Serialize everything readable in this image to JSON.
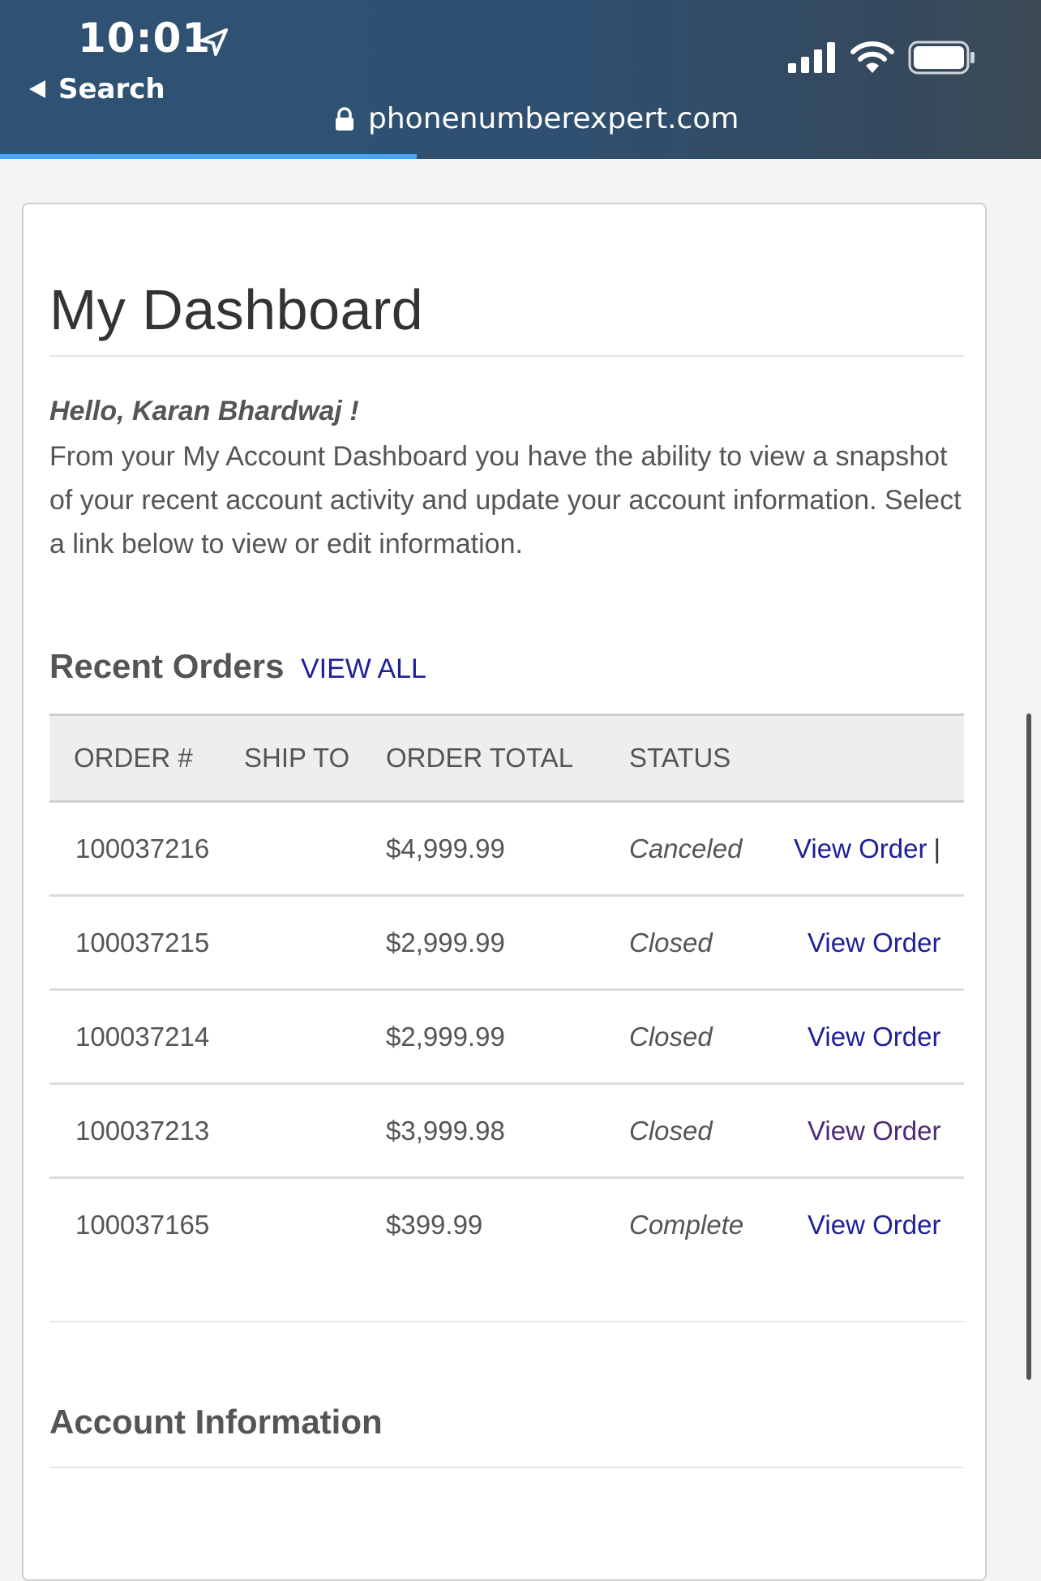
{
  "status_bar": {
    "time": "10:01",
    "back_label": "Search"
  },
  "browser": {
    "url": "phonenumberexpert.com"
  },
  "dashboard": {
    "title": "My Dashboard",
    "greeting": "Hello, Karan Bhardwaj !",
    "intro": "From your My Account Dashboard you have the ability to view a snapshot of your recent account activity and update your account information. Select a link below to view or edit information."
  },
  "recent_orders": {
    "title": "Recent Orders",
    "view_all": "VIEW ALL",
    "columns": [
      "ORDER #",
      "SHIP TO",
      "ORDER TOTAL",
      "STATUS"
    ],
    "rows": [
      {
        "order": "100037216",
        "ship_to": "",
        "total": "$4,999.99",
        "status": "Canceled",
        "action": "View Order",
        "separator": "|"
      },
      {
        "order": "100037215",
        "ship_to": "",
        "total": "$2,999.99",
        "status": "Closed",
        "action": "View Order"
      },
      {
        "order": "100037214",
        "ship_to": "",
        "total": "$2,999.99",
        "status": "Closed",
        "action": "View Order"
      },
      {
        "order": "100037213",
        "ship_to": "",
        "total": "$3,999.98",
        "status": "Closed",
        "action": "View Order"
      },
      {
        "order": "100037165",
        "ship_to": "",
        "total": "$399.99",
        "status": "Complete",
        "action": "View Order"
      }
    ]
  },
  "account_information": {
    "title": "Account Information"
  },
  "colors": {
    "topbar": "#2f5274",
    "link": "#1f1f9a",
    "visited_link": "#4b2a78",
    "progress": "#4aa3ff"
  },
  "icons": [
    "location-arrow-icon",
    "back-triangle-icon",
    "cellular-signal-icon",
    "wifi-icon",
    "battery-icon",
    "lock-icon"
  ]
}
